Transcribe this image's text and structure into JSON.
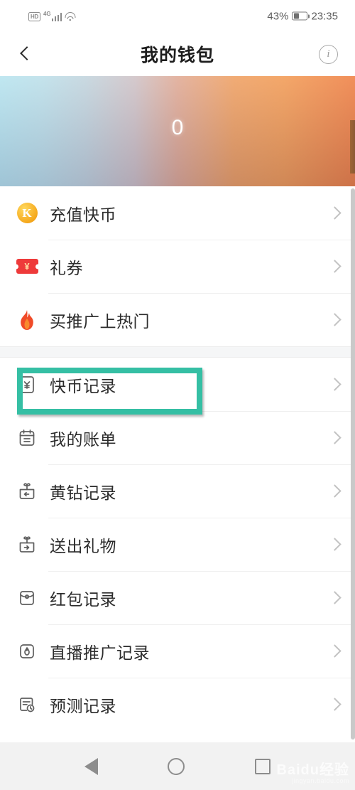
{
  "status_bar": {
    "hd_label": "HD",
    "network_label": "4G",
    "battery_percent": "43%",
    "time": "23:35"
  },
  "header": {
    "back_icon": "chevron-left-icon",
    "title": "我的钱包",
    "info_icon": "info-icon",
    "info_glyph": "i"
  },
  "banner": {
    "amount": "0",
    "gradient_from": "#b7e4ef",
    "gradient_to": "#ef8044"
  },
  "list": {
    "group_one": [
      {
        "icon": "coin-k-icon",
        "glyph": "K",
        "label": "充值快币",
        "chevron": "chevron-right-icon"
      },
      {
        "icon": "ticket-yuan-icon",
        "glyph": "¥",
        "label": "礼券",
        "chevron": "chevron-right-icon"
      },
      {
        "icon": "flame-icon",
        "glyph": "",
        "label": "买推广上热门",
        "chevron": "chevron-right-icon"
      }
    ],
    "group_two": [
      {
        "icon": "coin-record-icon",
        "label": "快币记录",
        "chevron": "chevron-right-icon"
      },
      {
        "icon": "calendar-bill-icon",
        "label": "我的账单",
        "chevron": "chevron-right-icon"
      },
      {
        "icon": "gift-in-icon",
        "label": "黄钻记录",
        "chevron": "chevron-right-icon"
      },
      {
        "icon": "gift-out-icon",
        "label": "送出礼物",
        "chevron": "chevron-right-icon"
      },
      {
        "icon": "red-envelope-icon",
        "label": "红包记录",
        "chevron": "chevron-right-icon"
      },
      {
        "icon": "live-promo-icon",
        "label": "直播推广记录",
        "chevron": "chevron-right-icon"
      },
      {
        "icon": "forecast-icon",
        "label": "预测记录",
        "chevron": "chevron-right-icon"
      }
    ]
  },
  "highlight": {
    "target_label": "快币记录",
    "color": "#35bfa4"
  },
  "nav_bar": {
    "back": "nav-back-icon",
    "home": "nav-home-icon",
    "recents": "nav-recents-icon"
  },
  "watermark": {
    "brand": "Baidu经验",
    "url": "jingyan.baidu.com"
  }
}
